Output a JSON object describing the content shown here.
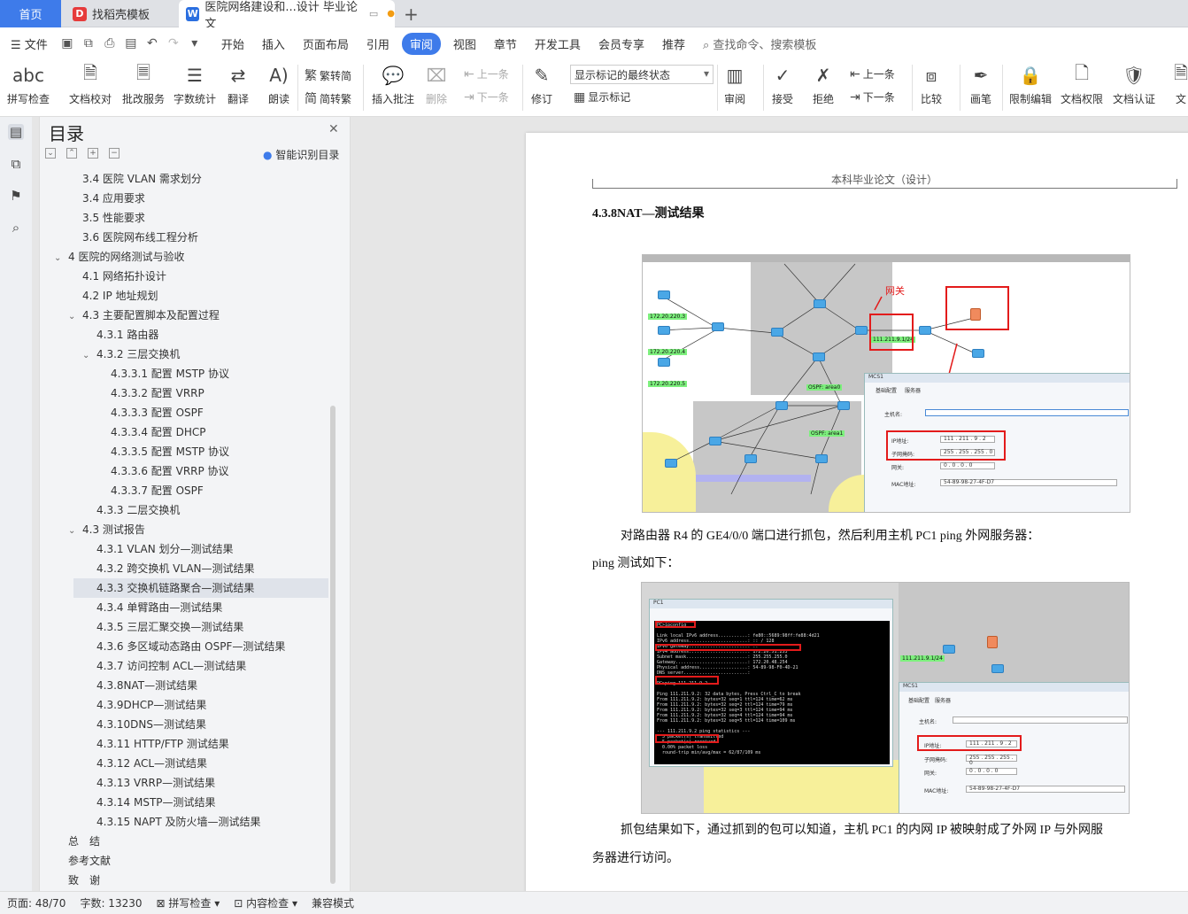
{
  "tabs": {
    "home": "首页",
    "templates": "找稻壳模板",
    "document": "医院网络建设和...设计 毕业论文"
  },
  "menu": {
    "file": "文件",
    "items": [
      "开始",
      "插入",
      "页面布局",
      "引用",
      "审阅",
      "视图",
      "章节",
      "开发工具",
      "会员专享",
      "推荐"
    ],
    "active": "审阅",
    "search": "查找命令、搜索模板"
  },
  "ribbon": {
    "spellcheck": "拼写检查",
    "doccheck": "文档校对",
    "review_service": "批改服务",
    "wordcount": "字数统计",
    "translate": "翻译",
    "read_aloud": "朗读",
    "trad_to_simp": "繁转简",
    "simp_to_trad": "简转繁",
    "insert_comment": "插入批注",
    "delete": "删除",
    "prev_comment": "上一条",
    "next_comment": "下一条",
    "revise": "修订",
    "markup_state": "显示标记的最终状态",
    "show_markup": "显示标记",
    "review": "审阅",
    "accept": "接受",
    "reject": "拒绝",
    "prev_change": "上一条",
    "next_change": "下一条",
    "compare": "比较",
    "draw": "画笔",
    "restrict_edit": "限制编辑",
    "doc_permission": "文档权限",
    "doc_certify": "文档认证",
    "doc_more": "文"
  },
  "toc": {
    "title": "目录",
    "smart": "智能识别目录",
    "items": [
      {
        "text": "3.4 医院 VLAN 需求划分",
        "level": 2,
        "arrow": ""
      },
      {
        "text": "3.4 应用要求",
        "level": 2,
        "arrow": ""
      },
      {
        "text": "3.5 性能要求",
        "level": 2,
        "arrow": ""
      },
      {
        "text": "3.6 医院网布线工程分析",
        "level": 2,
        "arrow": ""
      },
      {
        "text": "4 医院的网络测试与验收",
        "level": 1,
        "arrow": "v"
      },
      {
        "text": "4.1 网络拓扑设计",
        "level": 2,
        "arrow": ""
      },
      {
        "text": "4.2 IP 地址规划",
        "level": 2,
        "arrow": ""
      },
      {
        "text": "4.3 主要配置脚本及配置过程",
        "level": 2,
        "arrow": "v"
      },
      {
        "text": "4.3.1 路由器",
        "level": 3,
        "arrow": ""
      },
      {
        "text": "4.3.2 三层交换机",
        "level": 3,
        "arrow": "v"
      },
      {
        "text": "4.3.3.1 配置 MSTP 协议",
        "level": 4,
        "arrow": ""
      },
      {
        "text": "4.3.3.2 配置 VRRP",
        "level": 4,
        "arrow": ""
      },
      {
        "text": "4.3.3.3 配置 OSPF",
        "level": 4,
        "arrow": ""
      },
      {
        "text": "4.3.3.4 配置 DHCP",
        "level": 4,
        "arrow": ""
      },
      {
        "text": "4.3.3.5 配置 MSTP 协议",
        "level": 4,
        "arrow": ""
      },
      {
        "text": "4.3.3.6 配置 VRRP 协议",
        "level": 4,
        "arrow": ""
      },
      {
        "text": "4.3.3.7 配置 OSPF",
        "level": 4,
        "arrow": ""
      },
      {
        "text": "4.3.3 二层交换机",
        "level": 3,
        "arrow": ""
      },
      {
        "text": "4.3 测试报告",
        "level": 2,
        "arrow": "v"
      },
      {
        "text": "4.3.1 VLAN 划分—测试结果",
        "level": 3,
        "arrow": ""
      },
      {
        "text": "4.3.2 跨交换机 VLAN—测试结果",
        "level": 3,
        "arrow": ""
      },
      {
        "text": "4.3.3 交换机链路聚合—测试结果",
        "level": 3,
        "arrow": "",
        "selected": true
      },
      {
        "text": "4.3.4 单臂路由—测试结果",
        "level": 3,
        "arrow": ""
      },
      {
        "text": "4.3.5 三层汇聚交换—测试结果",
        "level": 3,
        "arrow": ""
      },
      {
        "text": "4.3.6 多区域动态路由 OSPF—测试结果",
        "level": 3,
        "arrow": ""
      },
      {
        "text": "4.3.7 访问控制 ACL—测试结果",
        "level": 3,
        "arrow": ""
      },
      {
        "text": "4.3.8NAT—测试结果",
        "level": 3,
        "arrow": ""
      },
      {
        "text": "4.3.9DHCP—测试结果",
        "level": 3,
        "arrow": ""
      },
      {
        "text": "4.3.10DNS—测试结果",
        "level": 3,
        "arrow": ""
      },
      {
        "text": "4.3.11 HTTP/FTP 测试结果",
        "level": 3,
        "arrow": ""
      },
      {
        "text": "4.3.12 ACL—测试结果",
        "level": 3,
        "arrow": ""
      },
      {
        "text": "4.3.13 VRRP—测试结果",
        "level": 3,
        "arrow": ""
      },
      {
        "text": "4.3.14 MSTP—测试结果",
        "level": 3,
        "arrow": ""
      },
      {
        "text": "4.3.15 NAPT 及防火墙—测试结果",
        "level": 3,
        "arrow": ""
      },
      {
        "text": "总　结",
        "level": 1,
        "arrow": ""
      },
      {
        "text": "参考文献",
        "level": 1,
        "arrow": ""
      },
      {
        "text": "致　谢",
        "level": 1,
        "arrow": ""
      }
    ]
  },
  "document": {
    "header": "本科毕业论文（设计）",
    "section_title": "4.3.8NAT—测试结果",
    "para1_line1": "对路由器 R4 的 GE4/0/0 端口进行抓包，然后利用主机 PC1 ping  外网服务器：",
    "para1_line2": "ping 测试如下：",
    "para2_line1": "抓包结果如下，通过抓到的包可以知道，主机 PC1 的内网 IP 被映射成了外网 IP 与外网服",
    "para2_line2": "务器进行访问。",
    "fig1": {
      "gateway_label": "网关",
      "dialog_title": "MCS1",
      "tab1": "基础配置",
      "tab2": "服务器",
      "host_label": "主机名:",
      "ip_label": "IP地址:",
      "ip_value": "111 . 211 . 9 . 2",
      "mask_label": "子网掩码:",
      "mask_value": "255 . 255 . 255 . 0",
      "gw_label": "网关:",
      "gw_value": "0 . 0 . 0 . 0",
      "mac_label": "MAC地址:",
      "mac_value": "54-89-98-27-4F-D7",
      "net_label": "111.211.9.1/24",
      "ospf_label": "OSPF: area0",
      "ospf_label2": "OSPF: area1",
      "dns_label": "172.20.220.3",
      "ftp_label": "172.20.220.4",
      "http_label": "172.20.220.5"
    },
    "fig2": {
      "window_title": "PC1",
      "terminal": "PC>ipconfig\n\nLink local IPv6 address...........: fe80::5689:98ff:fe88:4d21\nIPv6 address......................: :: / 128\nIPv6 gateway......................: ::\nIPv4 address......................: 172.20.51.253\nSubnet mask.......................: 255.255.255.0\nGateway...........................: 172.20.48.254\nPhysical address..................: 54-89-98-F0-4D-21\nDNS server........................:\n\nPC>ping 111.211.9.2\n\nPing 111.211.9.2: 32 data bytes, Press Ctrl_C to break\nFrom 111.211.9.2: bytes=32 seq=1 ttl=124 time=62 ms\nFrom 111.211.9.2: bytes=32 seq=2 ttl=124 time=79 ms\nFrom 111.211.9.2: bytes=32 seq=3 ttl=124 time=94 ms\nFrom 111.211.9.2: bytes=32 seq=4 ttl=124 time=94 ms\nFrom 111.211.9.2: bytes=32 seq=5 ttl=124 time=109 ms\n\n--- 111.211.9.2 ping statistics ---\n  5 packet(s) transmitted\n  5 packet(s) received\n  0.00% packet loss\n  round-trip min/avg/max = 62/87/109 ms"
    }
  },
  "status": {
    "page": "页面: 48/70",
    "words": "字数: 13230",
    "spell": "拼写检查",
    "content": "内容检查",
    "compat": "兼容模式"
  },
  "colors": {
    "accent": "#3e7bea",
    "red": "#e31b1b",
    "green_label": "#7df07d"
  }
}
